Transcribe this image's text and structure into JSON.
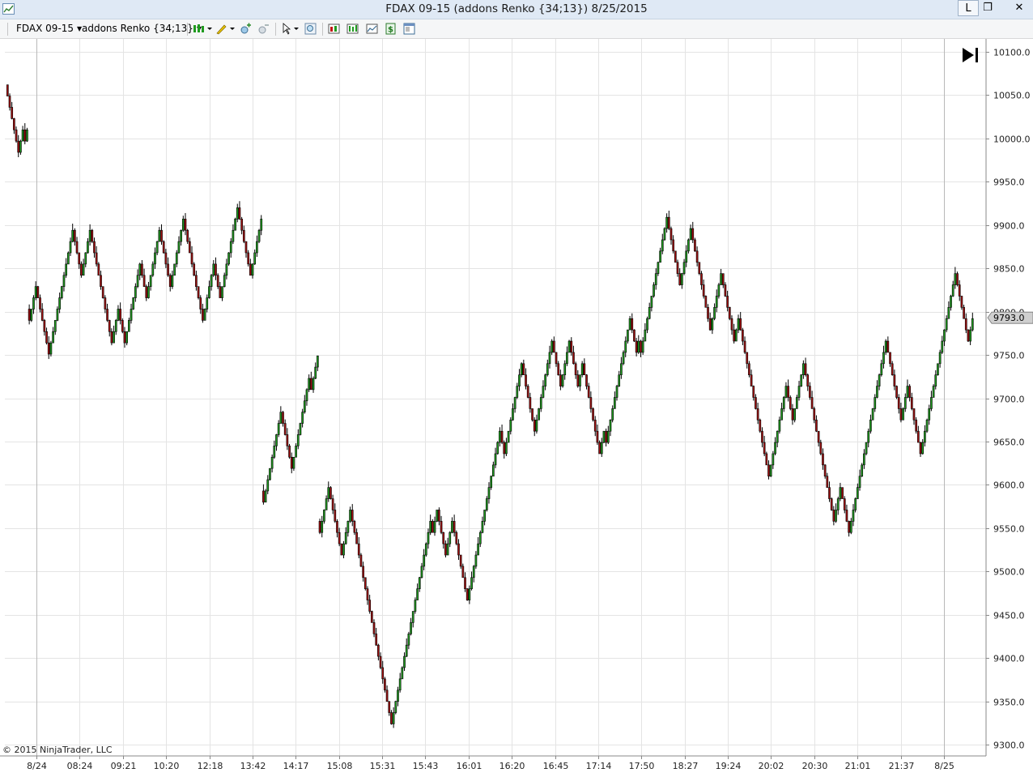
{
  "window": {
    "title": "FDAX 09-15 (addons Renko {34;13})  8/25/2015",
    "buttons": {
      "minimize": "L",
      "restore": "❐",
      "close": "✕"
    }
  },
  "toolbar": {
    "instrument": "FDAX 09-15",
    "bar_type": "addons Renko {34;13}",
    "icons": [
      "bar-style-icon",
      "pencil-draw-icon",
      "zoom-in-icon",
      "zoom-out-icon",
      "pointer-icon",
      "magnifier-icon",
      "indicators-icon",
      "strategies-icon",
      "chart-properties-icon",
      "dollar-icon",
      "data-box-icon"
    ]
  },
  "colors": {
    "up_bar": "#1f9a1f",
    "down_bar": "#a01010",
    "grid": "#e4e4e4",
    "last_price_box": "#cfcfcf"
  },
  "copyright": "© 2015 NinjaTrader, LLC",
  "chart_data": {
    "type": "renko",
    "instrument": "FDAX 09-15",
    "ylim": [
      9287,
      10115
    ],
    "yticks": [
      9300,
      9350,
      9400,
      9450,
      9500,
      9550,
      9600,
      9650,
      9700,
      9750,
      9800,
      9850,
      9900,
      9950,
      10000,
      10050,
      10100
    ],
    "ytick_labels": [
      "9300.0",
      "9350.0",
      "9400.0",
      "9450.0",
      "9500.0",
      "9550.0",
      "9600.0",
      "9650.0",
      "9700.0",
      "9750.0",
      "9800.0",
      "9850.0",
      "9900.0",
      "9950.0",
      "10000.0",
      "10050.0",
      "10100.0"
    ],
    "xtick_labels": [
      "8/24",
      "08:24",
      "09:21",
      "10:20",
      "12:18",
      "13:42",
      "14:17",
      "15:08",
      "15:31",
      "15:43",
      "16:01",
      "16:20",
      "16:45",
      "17:14",
      "17:50",
      "18:27",
      "19:24",
      "20:02",
      "20:30",
      "21:01",
      "21:37",
      "8/25"
    ],
    "last_price": "9793.0",
    "path": [
      10062,
      10010,
      9985,
      10005,
      9995,
      10010,
      9790,
      9830,
      9755,
      9765,
      9890,
      9840,
      9895,
      9770,
      9800,
      9760,
      9860,
      9820,
      9895,
      9825,
      9905,
      9790,
      9850,
      9820,
      9915,
      9850,
      9860,
      9845,
      9910,
      9580,
      9605,
      9690,
      9620,
      9640,
      9720,
      9705,
      9745,
      9545,
      9580,
      9600,
      9525,
      9550,
      9565,
      9448,
      9455,
      9325,
      9460,
      9485,
      9560,
      9545,
      9565,
      9525,
      9555,
      9470,
      9485,
      9660,
      9635,
      9675,
      9740,
      9710,
      9710,
      9660,
      9760,
      9720,
      9740,
      9765,
      9770,
      9710,
      9735,
      9640,
      9660,
      9650,
      9790,
      9755,
      9770,
      9755,
      9810,
      9905,
      9830,
      9900,
      9895,
      9775,
      9845,
      9770,
      9790,
      9640,
      9610,
      9720,
      9680,
      9740,
      9560,
      9600,
      9590,
      9570,
      9545,
      9590,
      9580,
      9760,
      9680,
      9710,
      9700,
      9630,
      9715,
      9845,
      9770,
      9760,
      9793
    ]
  }
}
